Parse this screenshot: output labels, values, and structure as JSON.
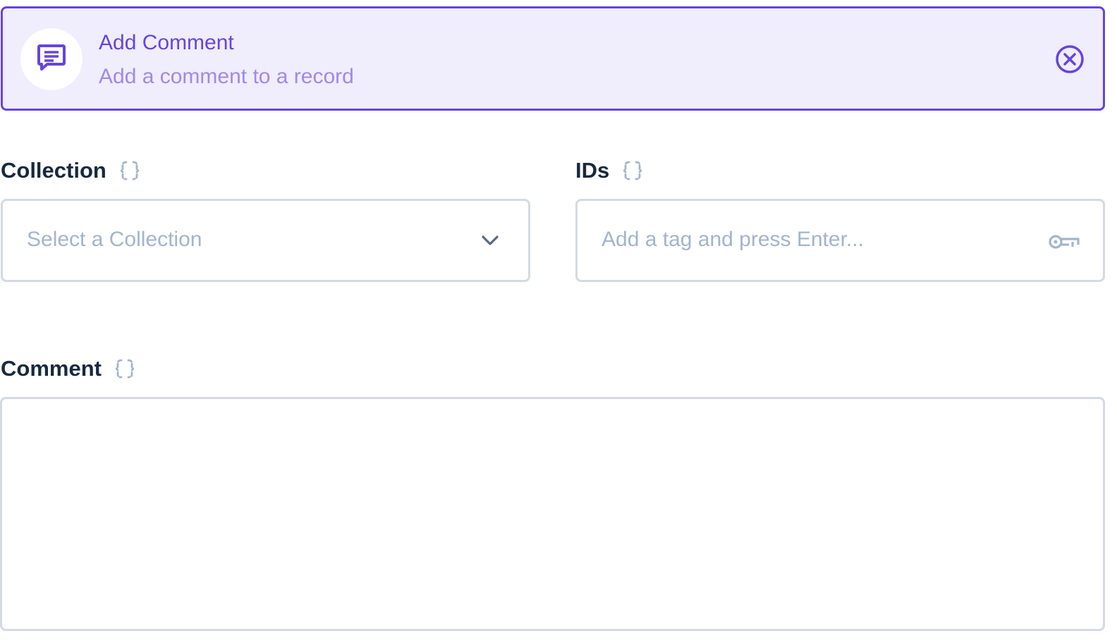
{
  "header": {
    "icon": "comment-icon",
    "title": "Add Comment",
    "subtitle": "Add a comment to a record",
    "close_icon": "close-circle-icon"
  },
  "fields": {
    "collection": {
      "label": "Collection",
      "raw_icon": "braces-icon",
      "placeholder": "Select a Collection",
      "value": "",
      "trailing_icon": "chevron-down-icon"
    },
    "ids": {
      "label": "IDs",
      "raw_icon": "braces-icon",
      "placeholder": "Add a tag and press Enter...",
      "value": "",
      "trailing_icon": "key-icon"
    },
    "comment": {
      "label": "Comment",
      "raw_icon": "braces-icon",
      "placeholder": "",
      "value": ""
    }
  },
  "colors": {
    "accent": "#6644dd",
    "accent_light": "#a08ae8",
    "header_bg": "#f0edfd",
    "label": "#172940",
    "border": "#d3dae4",
    "placeholder": "#a2b5cd",
    "icon_muted": "#a2b5cd"
  }
}
